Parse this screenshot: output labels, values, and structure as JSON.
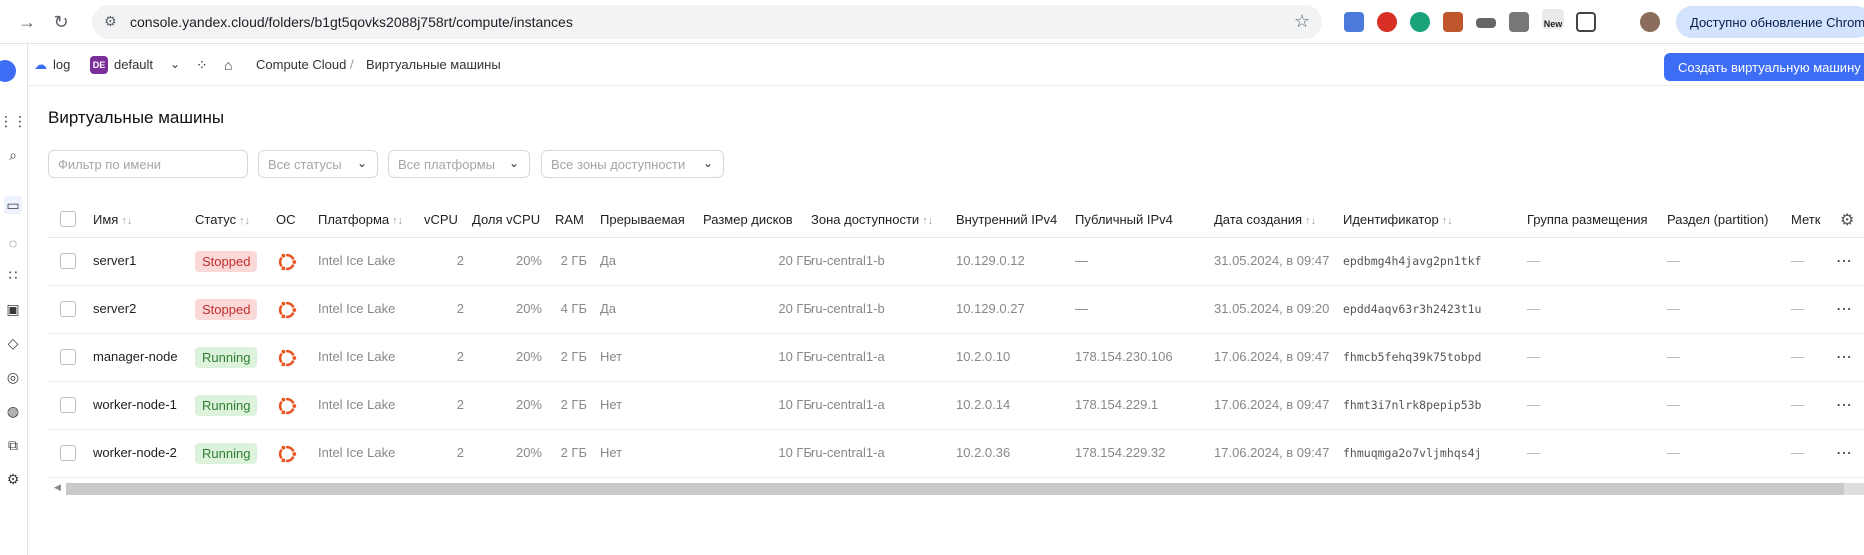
{
  "browser": {
    "url": "console.yandex.cloud/folders/b1gt5qovks2088j758rt/compute/instances",
    "update_label": "Доступно обновление Chrome",
    "ext_new_label": "New"
  },
  "topbar": {
    "cloud": "log",
    "folder_badge": "DE",
    "folder": "default",
    "breadcrumb_service": "Compute Cloud",
    "breadcrumb_sep": "/",
    "breadcrumb_page": "Виртуальные машины",
    "create_button": "Создать виртуальную машину"
  },
  "page": {
    "title": "Виртуальные машины",
    "filters": {
      "name_placeholder": "Фильтр по имени",
      "statuses": "Все статусы",
      "platforms": "Все платформы",
      "zones": "Все зоны доступности"
    }
  },
  "table": {
    "headers": {
      "name": "Имя",
      "status": "Статус",
      "os": "ОС",
      "platform": "Платформа",
      "vcpu": "vCPU",
      "vcpu_share": "Доля vCPU",
      "ram": "RAM",
      "preemptible": "Прерываемая",
      "disk_size": "Размер дисков",
      "zone": "Зона доступности",
      "internal_ip": "Внутренний IPv4",
      "public_ip": "Публичный IPv4",
      "created": "Дата создания",
      "id": "Идентификатор",
      "placement_group": "Группа размещения",
      "partition": "Раздел (partition)",
      "labels": "Метк"
    },
    "rows": [
      {
        "name": "server1",
        "status": "Stopped",
        "platform": "Intel Ice Lake",
        "vcpu": "2",
        "vcpu_share": "20%",
        "ram": "2 ГБ",
        "preemptible": "Да",
        "disk_size": "20 ГБ",
        "zone": "ru-central1-b",
        "internal_ip": "10.129.0.12",
        "public_ip": "—",
        "created": "31.05.2024, в 09:47",
        "id": "epdbmg4h4javg2pn1tkf",
        "placement_group": "—",
        "partition": "—",
        "labels": "—"
      },
      {
        "name": "server2",
        "status": "Stopped",
        "platform": "Intel Ice Lake",
        "vcpu": "2",
        "vcpu_share": "20%",
        "ram": "4 ГБ",
        "preemptible": "Да",
        "disk_size": "20 ГБ",
        "zone": "ru-central1-b",
        "internal_ip": "10.129.0.27",
        "public_ip": "—",
        "created": "31.05.2024, в 09:20",
        "id": "epdd4aqv63r3h2423t1u",
        "placement_group": "—",
        "partition": "—",
        "labels": "—"
      },
      {
        "name": "manager-node",
        "status": "Running",
        "platform": "Intel Ice Lake",
        "vcpu": "2",
        "vcpu_share": "20%",
        "ram": "2 ГБ",
        "preemptible": "Нет",
        "disk_size": "10 ГБ",
        "zone": "ru-central1-a",
        "internal_ip": "10.2.0.10",
        "public_ip": "178.154.230.106",
        "created": "17.06.2024, в 09:47",
        "id": "fhmcb5fehq39k75tobpd",
        "placement_group": "—",
        "partition": "—",
        "labels": "—"
      },
      {
        "name": "worker-node-1",
        "status": "Running",
        "platform": "Intel Ice Lake",
        "vcpu": "2",
        "vcpu_share": "20%",
        "ram": "2 ГБ",
        "preemptible": "Нет",
        "disk_size": "10 ГБ",
        "zone": "ru-central1-a",
        "internal_ip": "10.2.0.14",
        "public_ip": "178.154.229.1",
        "created": "17.06.2024, в 09:47",
        "id": "fhmt3i7nlrk8pepip53b",
        "placement_group": "—",
        "partition": "—",
        "labels": "—"
      },
      {
        "name": "worker-node-2",
        "status": "Running",
        "platform": "Intel Ice Lake",
        "vcpu": "2",
        "vcpu_share": "20%",
        "ram": "2 ГБ",
        "preemptible": "Нет",
        "disk_size": "10 ГБ",
        "zone": "ru-central1-a",
        "internal_ip": "10.2.0.36",
        "public_ip": "178.154.229.32",
        "created": "17.06.2024, в 09:47",
        "id": "fhmuqmga2o7vljmhqs4j",
        "placement_group": "—",
        "partition": "—",
        "labels": "—"
      }
    ]
  },
  "icons": {
    "os": "ubuntu-icon",
    "sort": "sort-arrows-icon",
    "row_menu": "more-dots-icon",
    "settings": "gear-icon"
  },
  "colors": {
    "accent": "#3d6cf5",
    "stopped_bg": "#fbd8d8",
    "stopped_text": "#c22e2e",
    "running_bg": "#dcf2da",
    "running_text": "#2e7d32",
    "ubuntu": "#e95420"
  }
}
